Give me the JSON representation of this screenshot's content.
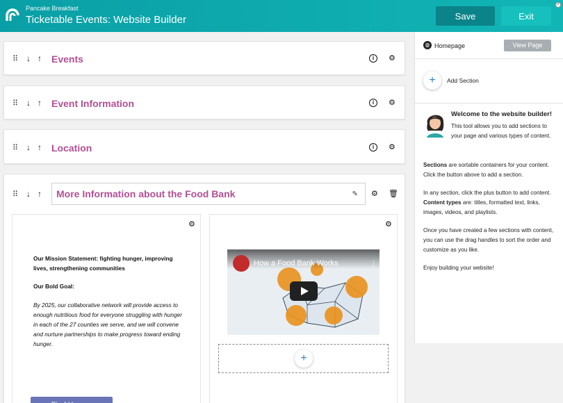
{
  "header": {
    "org_name": "Pancake Breakfast",
    "app_title": "Ticketable Events: Website Builder",
    "save_label": "Save",
    "exit_label": "Exit",
    "brand_color": "#12b5b5"
  },
  "sections": [
    {
      "title": "Events"
    },
    {
      "title": "Event Information"
    },
    {
      "title": "Location"
    },
    {
      "title": "More Information about the Food Bank"
    }
  ],
  "content": {
    "mission": "Our Mission Statement:  fighting hunger, improving lives, strengthening communities",
    "goal_heading": "Our Bold Goal:",
    "goal_text": "By 2025, our collaborative network will provide access to enough nutritious food for everyone struggling with hunger in each of the 27 counties we serve, and we will convene and nurture partnerships to make progress toward ending hunger.",
    "button_label": "Find Your ...",
    "video_title": "How a Food Bank Works"
  },
  "sidebar": {
    "page_name": "Homepage",
    "view_page_label": "View Page",
    "add_section_label": "Add Section",
    "welcome_title": "Welcome to the website builder!",
    "welcome_text": "This tool allows you to add sections to your page and various types of content.",
    "sections_term": "Sections",
    "sections_text": " are sortable containers for your content. Click the button above to add a section.",
    "content_text_1": "In any section, click the plus button to add content. ",
    "content_types_term": "Content types",
    "content_text_2": " are: titles, formatted text, links, images, videos, and playlists.",
    "sort_text": "Once you have created a few sections with content, you can use the drag handles to sort the order and customize as you like.",
    "enjoy_text": "Enjoy building your website!"
  }
}
